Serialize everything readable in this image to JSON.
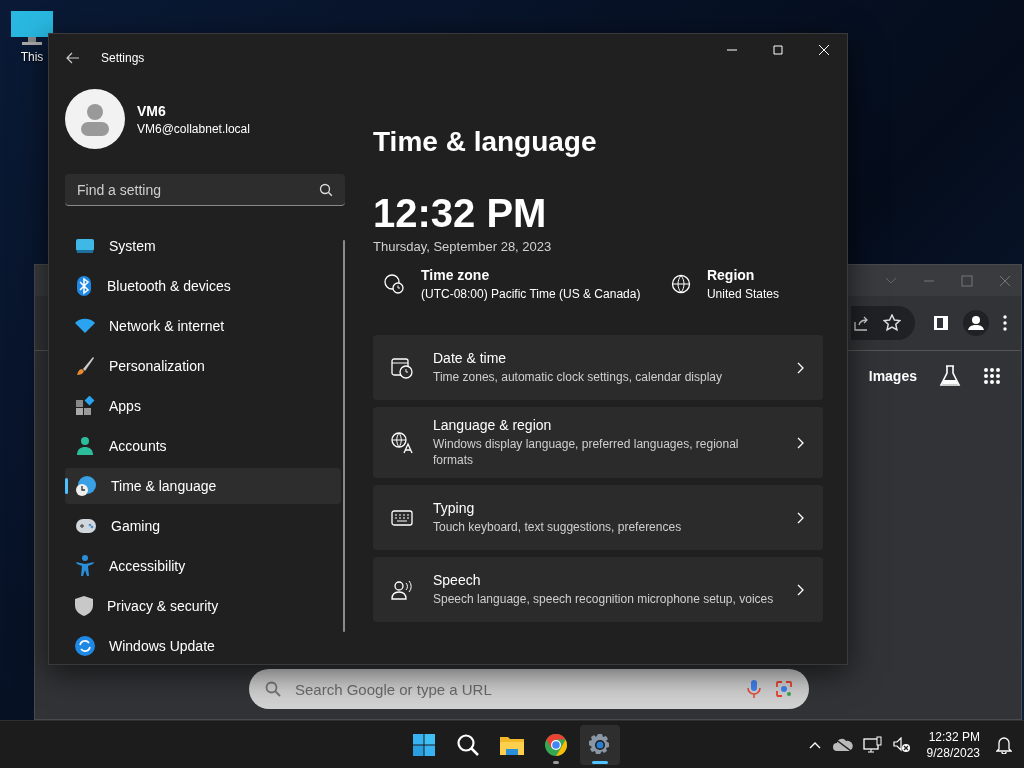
{
  "desktop_icons": [
    {
      "label": "This"
    }
  ],
  "browser_window": {
    "toolbar_link": "Images",
    "search": {
      "placeholder": "Search Google or type a URL"
    }
  },
  "settings_window": {
    "title": "Settings",
    "account": {
      "name": "VM6",
      "email": "VM6@collabnet.local"
    },
    "search": {
      "placeholder": "Find a setting"
    },
    "nav": [
      {
        "label": "System",
        "selected": false
      },
      {
        "label": "Bluetooth & devices",
        "selected": false
      },
      {
        "label": "Network & internet",
        "selected": false
      },
      {
        "label": "Personalization",
        "selected": false
      },
      {
        "label": "Apps",
        "selected": false
      },
      {
        "label": "Accounts",
        "selected": false
      },
      {
        "label": "Time & language",
        "selected": true
      },
      {
        "label": "Gaming",
        "selected": false
      },
      {
        "label": "Accessibility",
        "selected": false
      },
      {
        "label": "Privacy & security",
        "selected": false
      },
      {
        "label": "Windows Update",
        "selected": false
      }
    ],
    "page": {
      "title": "Time & language",
      "time": "12:32 PM",
      "date": "Thursday, September 28, 2023",
      "info": [
        {
          "label": "Time zone",
          "value": "(UTC-08:00) Pacific Time (US & Canada)"
        },
        {
          "label": "Region",
          "value": "United States"
        }
      ],
      "cards": [
        {
          "title": "Date & time",
          "description": "Time zones, automatic clock settings, calendar display"
        },
        {
          "title": "Language & region",
          "description": "Windows display language, preferred languages, regional formats"
        },
        {
          "title": "Typing",
          "description": "Touch keyboard, text suggestions, preferences"
        },
        {
          "title": "Speech",
          "description": "Speech language, speech recognition microphone setup, voices"
        }
      ]
    }
  },
  "taskbar": {
    "apps": [
      {
        "kind": "start",
        "active": false,
        "running": false
      },
      {
        "kind": "search",
        "active": false,
        "running": false
      },
      {
        "kind": "explorer",
        "active": false,
        "running": false
      },
      {
        "kind": "chrome",
        "active": false,
        "running": true
      },
      {
        "kind": "settings",
        "active": true,
        "running": true
      }
    ],
    "time": "12:32 PM",
    "date": "9/28/2023"
  }
}
